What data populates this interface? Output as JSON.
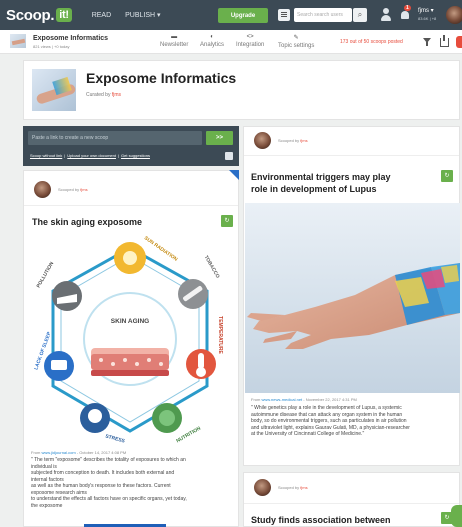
{
  "topbar": {
    "logo": "Scoop.",
    "logo_it": "it!",
    "nav_read": "READ",
    "nav_publish": "PUBLISH ▾",
    "upgrade": "Upgrade",
    "search_placeholder": "Search search users",
    "notifications_count": "1",
    "user_name": "fjms ▾",
    "user_stats": "83.6K | +8"
  },
  "subbar": {
    "topic_title": "Exposome Informatics",
    "topic_meta": "821 views | +0 today",
    "nav": [
      {
        "label": "Newsletter",
        "icon": "newsletter-icon"
      },
      {
        "label": "Analytics",
        "icon": "analytics-icon"
      },
      {
        "label": "Integration",
        "icon": "integration-icon"
      },
      {
        "label": "Topic settings",
        "icon": "settings-icon"
      }
    ],
    "scoops_posted": "173 out of 50 scoops posted"
  },
  "topic_header": {
    "title": "Exposome Informatics",
    "curated_by_label": "Curated by",
    "curator": "fjms"
  },
  "suggest": {
    "placeholder": "Paste a link to create a new scoop",
    "button": ">>",
    "links": [
      "Scoop without link",
      "Upload your own document",
      "Get suggestions"
    ]
  },
  "cards": {
    "skin_aging": {
      "scooped_by_label": "Scooped by",
      "curator": "fjms",
      "title": "The skin aging exposome",
      "scoop_btn": "↻",
      "infographic": {
        "center": "SKIN AGING",
        "segments": [
          "SUN RADIATION",
          "TOBACCO",
          "TEMPERATURE",
          "NUTRITION",
          "STRESS",
          "LACK OF SLEEP",
          "POLLUTION"
        ]
      },
      "from_label": "From",
      "source": "www.jidjournal.com",
      "date": " - October 14, 2017 4:08 PM",
      "text": [
        "\" The term \"exposome\" describes the totality of exposures to which an",
        "individual is",
        "subjected from conception to death. It includes both external and",
        "internal factors",
        "as well as the human body's response to these factors. Current",
        "exposome research aims",
        "to understand the effects all factors have on specific organs, yet today,",
        "the exposome"
      ]
    },
    "lupus": {
      "scooped_by_label": "Scooped by",
      "curator": "fjms",
      "title_line1": "Environmental triggers may play",
      "title_line2": "role in development of Lupus",
      "scoop_btn": "↻",
      "from_label": "From",
      "source": "www.news-medical.net",
      "date": " - November 22, 2017 4:31 PM",
      "text": [
        "\" While genetics play a role in the development of Lupus, a systemic",
        "autoimmune disease that can attack any organ system in the human",
        "body, so do environmental triggers, such as particulates in air pollution",
        "and ultraviolet light, explains Gaurav Gulati, MD, a physician-researcher",
        "at the University of Cincinnati College of Medicine.\""
      ]
    },
    "association": {
      "scooped_by_label": "Scooped by",
      "curator": "fjms",
      "title": "Study finds association between",
      "scoop_btn": "↻"
    }
  },
  "colors": {
    "topbar": "#3c4a55",
    "green": "#6ab04c",
    "red": "#e74c3c",
    "link_blue": "#2a8bd0"
  }
}
